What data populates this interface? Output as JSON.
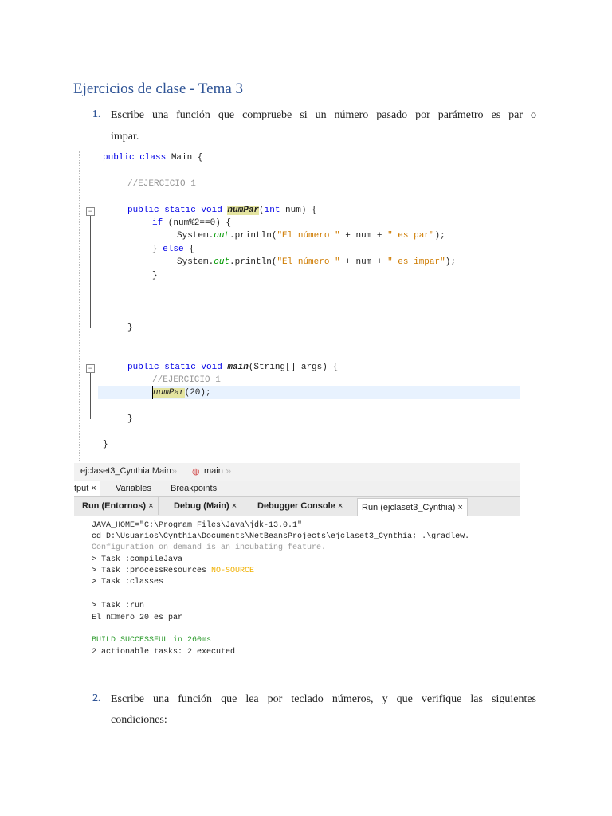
{
  "title": "Ejercicios de clase - Tema 3",
  "items": [
    {
      "number": "1.",
      "line1": "Escribe una función que compruebe si un número pasado por parámetro es par o",
      "line2": "impar."
    },
    {
      "number": "2.",
      "line1": "Escribe una función que lea por teclado números, y que verifique las siguientes",
      "line2": "condiciones:"
    }
  ],
  "code": {
    "l0a": "public class ",
    "l0b": "Main {",
    "l1": "//EJERCICIO 1",
    "l2kw": "public static void ",
    "l2fn": "numPar",
    "l2a": "(",
    "l2kw2": "int",
    " l2b": "",
    "l2c": " num) {",
    "l3kw": "if",
    " l3": "",
    "l3b": " (num%2==0) {",
    "l4a": "System.",
    "l4it": "out",
    "l4b": ".println(",
    "l4s1": "\"El número \"",
    "l4c": " + num + ",
    "l4s2": "\" es par\"",
    "l4d": ");",
    "l5a": "} ",
    "l5kw": "else",
    "l5b": " {",
    "l6a": "System.",
    "l6it": "out",
    "l6b": ".println(",
    "l6s1": "\"El número \"",
    "l6c": " + num + ",
    "l6s2": "\" es impar\"",
    "l6d": ");",
    "l7": "}",
    "l8": "}",
    "l9kw": "public static void ",
    "l9fn": "main",
    "l9b": "(String[] args) {",
    "l10": "//EJERCICIO 1",
    "l11fn": "numPar",
    "l11b": "(20);",
    "l12": "}",
    "l13": "}"
  },
  "ide": {
    "breadcrumb": [
      "ejclaset3_Cynthia.Main",
      "main"
    ],
    "panel_tabs": [
      "tput",
      "Variables",
      "Breakpoints"
    ],
    "output_tabs": [
      "Run (Entornos)",
      "Debug (Main)",
      "Debugger Console",
      "Run (ejclaset3_Cynthia)"
    ],
    "close": "×",
    "sep": "»",
    "console": {
      "l1": "JAVA_HOME=\"C:\\Program Files\\Java\\jdk-13.0.1\"",
      "l2": "cd D:\\Usuarios\\Cynthia\\Documents\\NetBeansProjects\\ejclaset3_Cynthia; .\\gradlew.",
      "l3": "Configuration on demand is an incubating feature.",
      "l4": "> Task :compileJava",
      "l5a": "> Task :processResources ",
      "l5b": "NO-SOURCE",
      "l6": "> Task :classes",
      "l7": "> Task :run",
      "l8": "El n□mero 20 es par",
      "l9": "BUILD SUCCESSFUL in 260ms",
      "l10": "2 actionable tasks: 2 executed"
    }
  },
  "colors": {
    "heading": "#2f5496",
    "keyword": "#0000e6",
    "string": "#ce7b00",
    "success": "#2a9a2a"
  }
}
